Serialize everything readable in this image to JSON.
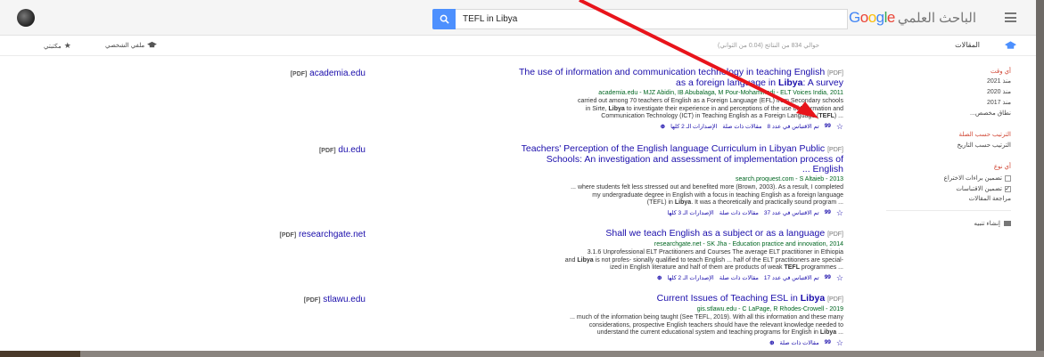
{
  "colors": {
    "accent": "#4d90fe",
    "link": "#1a0dab",
    "green": "#006621",
    "red": "#d14836",
    "arrow": "#e8141b"
  },
  "header": {
    "search_value": "TEFL in Libya",
    "logo_google": "Google",
    "logo_scholar": "الباحث العلمي"
  },
  "subbar": {
    "library": "مكتبتي",
    "profile": "ملفي الشخصي",
    "count": "حوالي 834 من النتائج (0.04 من الثواني)",
    "articles": "المقالات"
  },
  "sidebar": {
    "anytime": "أي وقت",
    "since_2021": "منذ 2021",
    "since_2020": "منذ 2020",
    "since_2017": "منذ 2017",
    "custom_range": "نطاق مخصص...",
    "sort_relevance": "الترتيب حسب الصلة",
    "sort_date": "الترتيب حسب التاريخ",
    "any_type": "أي نوع",
    "include_patents": "تضمين براءات الاختراع",
    "include_citations": "تضمين الاقتباسات",
    "review_articles": "مراجعة المقالات",
    "create_alert": "إنشاء تنبيه"
  },
  "results": [
    {
      "source": "academia.edu",
      "source_tag": "[PDF]",
      "pdf_tag": "[PDF]",
      "title_part1": "The use of information and communication technology in teaching English",
      "title_part2": "as a foreign language in",
      "title_bold": "Libya",
      "title_part3": ": A survey",
      "meta": "academia.edu - MJZ Abidin, IB Abubalaga, M Pour-Mohammadi - ELT Voices India, 2011",
      "snippet1": "carried out among 70 teachers of English as a Foreign Language (EFL) from Secondary schools",
      "snippet2": "in Sirte,",
      "snippet2_bold": "Libya",
      "snippet2_rest": "to investigate their experience in and perceptions of the use of Information and",
      "snippet3": "Communication Technology (ICT) in Teaching English as a Foreign Language (",
      "snippet3_bold": "TEFL",
      "snippet3_rest": ") ...",
      "cited": "تم الاقتباس في عدد 8",
      "related": "مقالات ذات صلة",
      "versions": "الإصدارات الـ 2 كلها"
    },
    {
      "source": "du.edu",
      "source_tag": "[PDF]",
      "pdf_tag": "[PDF]",
      "title_part1": "Teachers' Perception of the English language Curriculum in Libyan Public",
      "title_part2": "Schools: An investigation and assessment of implementation process of",
      "title_part3": "English ...",
      "meta": "search.proquest.com - S Altaieb - 2013",
      "snippet1": "... where students felt less stressed out and benefited more (Brown, 2003). As a result, I completed",
      "snippet2": "my undergraduate degree in English with a focus in teaching English as a foreign language",
      "snippet3": "(TEFL) in",
      "snippet3_bold": "Libya",
      "snippet3_rest": ". It was a theoretically and practically sound program ...",
      "cited": "تم الاقتباس في عدد 37",
      "related": "مقالات ذات صلة",
      "versions": "الإصدارات الـ 3 كلها"
    },
    {
      "source": "researchgate.net",
      "source_tag": "[PDF]",
      "pdf_tag": "[PDF]",
      "title_part1": "Shall we teach English as a subject or as a language",
      "meta": "researchgate.net - SK Jha - Education practice and innovation, 2014",
      "snippet1": "3.1.6 Unprofessional ELT Practitioners and Courses The average ELT practitioner in Ethiopia",
      "snippet2": "and",
      "snippet2_bold": "Libya",
      "snippet2_rest": "is not profes- sionally qualified to teach English ... half of the ELT practitioners are special-",
      "snippet3": "ized in English literature and half of them are products of weak",
      "snippet3_bold": "TEFL",
      "snippet3_rest": "programmes ...",
      "cited": "تم الاقتباس في عدد 17",
      "related": "مقالات ذات صلة",
      "versions": "الإصدارات الـ 2 كلها"
    },
    {
      "source": "stlawu.edu",
      "source_tag": "[PDF]",
      "pdf_tag": "[PDF]",
      "title_part1": "Current Issues of Teaching ESL in",
      "title_bold": "Libya",
      "meta": "gis.stlawu.edu - C LaPage, R Rhodes-Crowell - 2019",
      "snippet1": "... much of the information being taught (See TEFL, 2019). With all this information and these many",
      "snippet2": "considerations, prospective English teachers should have the relevant knowledge needed to",
      "snippet3": "understand the current educational system and teaching programs for English in",
      "snippet3_bold": "Libya",
      "snippet3_rest": "...",
      "related": "مقالات ذات صلة"
    }
  ]
}
